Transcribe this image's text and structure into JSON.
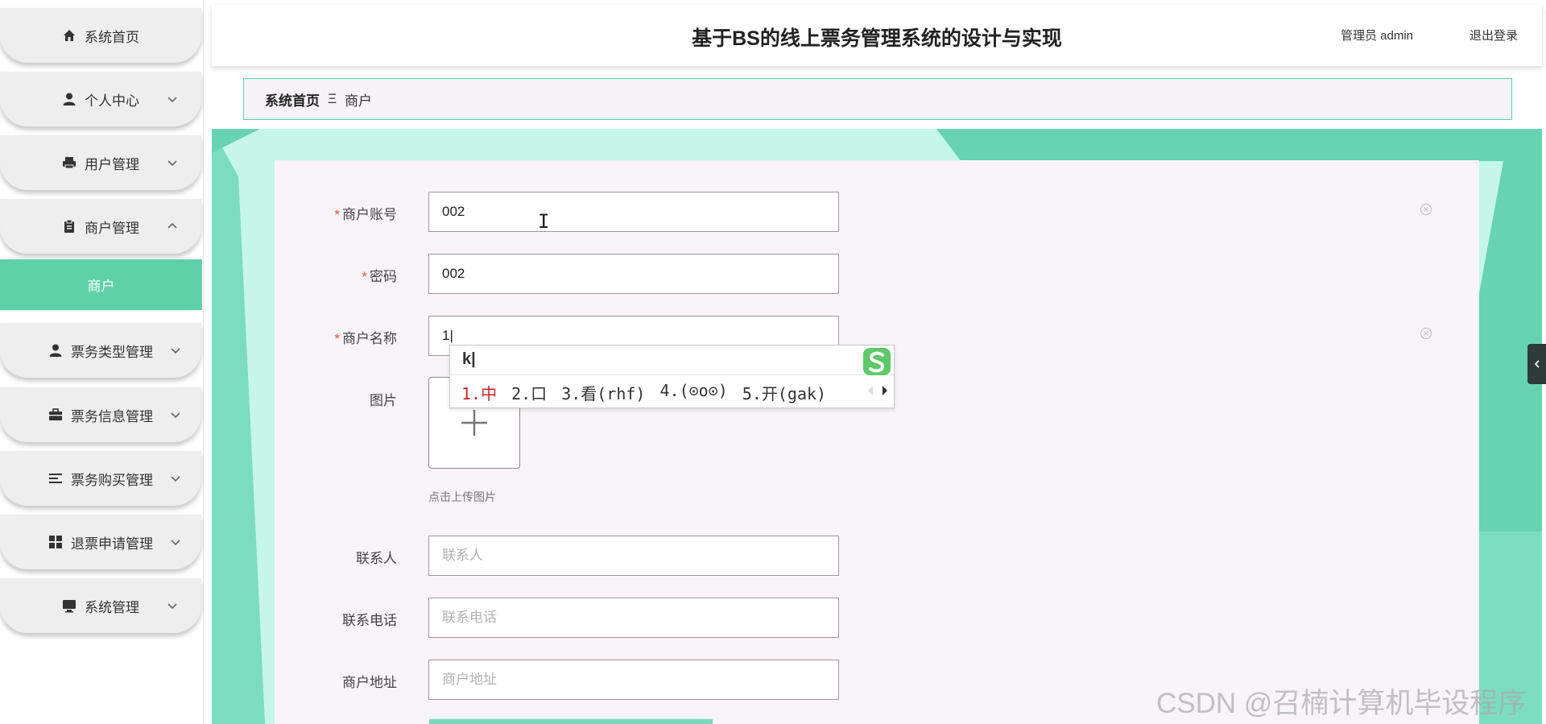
{
  "app": {
    "title": "基于BS的线上票务管理系统的设计与实现",
    "user_label": "管理员 admin",
    "logout_label": "退出登录"
  },
  "sidebar": {
    "items": [
      {
        "label": "系统首页",
        "icon": "home-icon"
      },
      {
        "label": "个人中心",
        "icon": "person-icon"
      },
      {
        "label": "用户管理",
        "icon": "printer-icon"
      },
      {
        "label": "商户管理",
        "icon": "clipboard-icon"
      },
      {
        "label": "票务类型管理",
        "icon": "person-icon"
      },
      {
        "label": "票务信息管理",
        "icon": "briefcase-icon"
      },
      {
        "label": "票务购买管理",
        "icon": "list-icon"
      },
      {
        "label": "退票申请管理",
        "icon": "grid-icon"
      },
      {
        "label": "系统管理",
        "icon": "monitor-icon"
      }
    ],
    "submenu": {
      "label": "商户"
    },
    "accent": "#5fd1a9"
  },
  "breadcrumb": {
    "home": "系统首页",
    "separator": "Ξ",
    "current": "商户"
  },
  "form": {
    "account": {
      "label": "商户账号",
      "value": "002"
    },
    "password": {
      "label": "密码",
      "value": "002"
    },
    "name": {
      "label": "商户名称",
      "value": "1|"
    },
    "image": {
      "label": "图片",
      "tip": "点击上传图片"
    },
    "contact": {
      "label": "联系人",
      "placeholder": "联系人"
    },
    "phone": {
      "label": "联系电话",
      "placeholder": "联系电话"
    },
    "address": {
      "label": "商户地址",
      "placeholder": "商户地址"
    },
    "required_mark": "*"
  },
  "ime": {
    "typed": "k|",
    "candidates": [
      "1.中",
      "2.口",
      "3.看(rhf)",
      "4.(⊙o⊙)",
      "5.开(gak)"
    ]
  },
  "watermark": "CSDN @召楠计算机毕设程序"
}
